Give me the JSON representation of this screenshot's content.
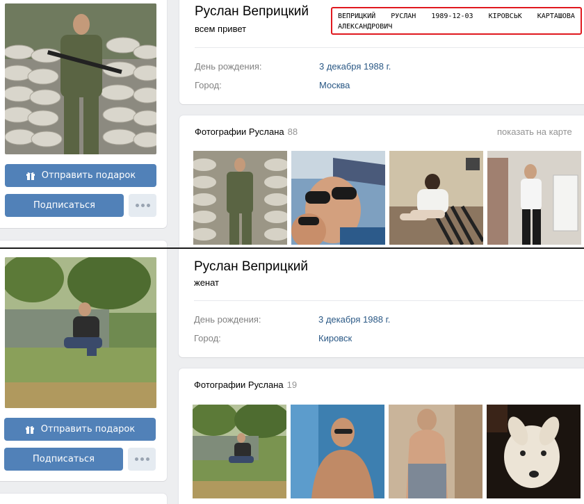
{
  "profile_1": {
    "name": "Руслан Веприцкий",
    "status": "всем привет",
    "annotation_line1": [
      "ВЕПРИЦКИЙ",
      "РУСЛАН",
      "1989-12-03",
      "КІРОВСЬК",
      "КАРТАШОВА"
    ],
    "annotation_line2": "АЛЕКСАНДРОВИЧ",
    "birthday_label": "День рождения:",
    "birthday_value": "3 декабря 1988 г.",
    "city_label": "Город:",
    "city_value": "Москва",
    "gift_button": "Отправить подарок",
    "subscribe_button": "Подписаться",
    "photos_title": "Фотографии Руслана",
    "photos_count": "88",
    "map_link": "показать на карте"
  },
  "profile_2": {
    "name": "Руслан Веприцкий",
    "status": "женат",
    "birthday_label": "День рождения:",
    "birthday_value": "3 декабря 1988 г.",
    "city_label": "Город:",
    "city_value": "Кировск",
    "gift_button": "Отправить подарок",
    "subscribe_button": "Подписаться",
    "photos_title": "Фотографии Руслана",
    "photos_count": "19"
  },
  "colors": {
    "accent": "#5181b8",
    "link": "#2a5885",
    "label": "#828282",
    "highlight_border": "#e0181e",
    "background": "#edeef0"
  },
  "icons": [
    "gift-icon",
    "more-dots-icon"
  ]
}
